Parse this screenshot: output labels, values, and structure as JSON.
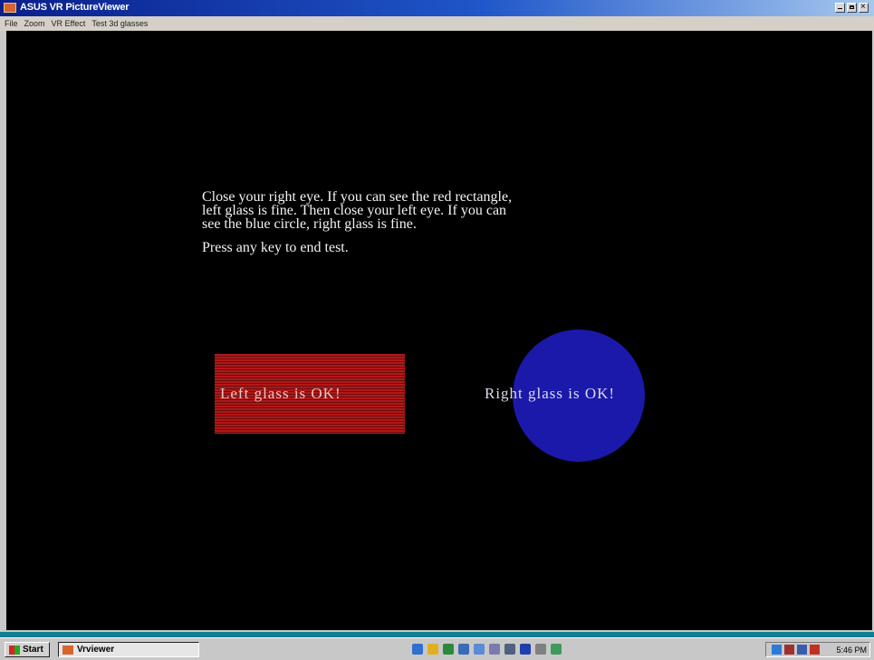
{
  "window": {
    "title": "ASUS VR PictureViewer",
    "buttons": [
      "minimize-icon",
      "maximize-icon",
      "close-icon"
    ]
  },
  "menu": {
    "items": [
      "File",
      "Zoom",
      "VR Effect",
      "Test 3d glasses"
    ]
  },
  "content": {
    "instructions": "Close your right eye. If you can see the red rectangle,\nleft glass is fine. Then close your left eye. If you can\nsee the blue circle, right glass is fine.",
    "press_key": "Press any key to end test.",
    "left_label": "Left glass is OK!",
    "right_label": "Right glass is OK!"
  },
  "colors": {
    "red_rect": "#b21818",
    "blue_circle": "#1b19a9",
    "titlebar": "#0a1f8c",
    "taskbar_accent": "#0f7f8f"
  },
  "taskbar": {
    "start_label": "Start",
    "task_label": "Vrviewer",
    "quick_launch_icons": [
      "ie-icon",
      "outlook-icon",
      "media-icon",
      "desktop-icon",
      "window-icon",
      "network-icon",
      "printer-icon",
      "app-icon",
      "app2-icon",
      "app3-icon"
    ],
    "clock": "5:46 PM"
  }
}
